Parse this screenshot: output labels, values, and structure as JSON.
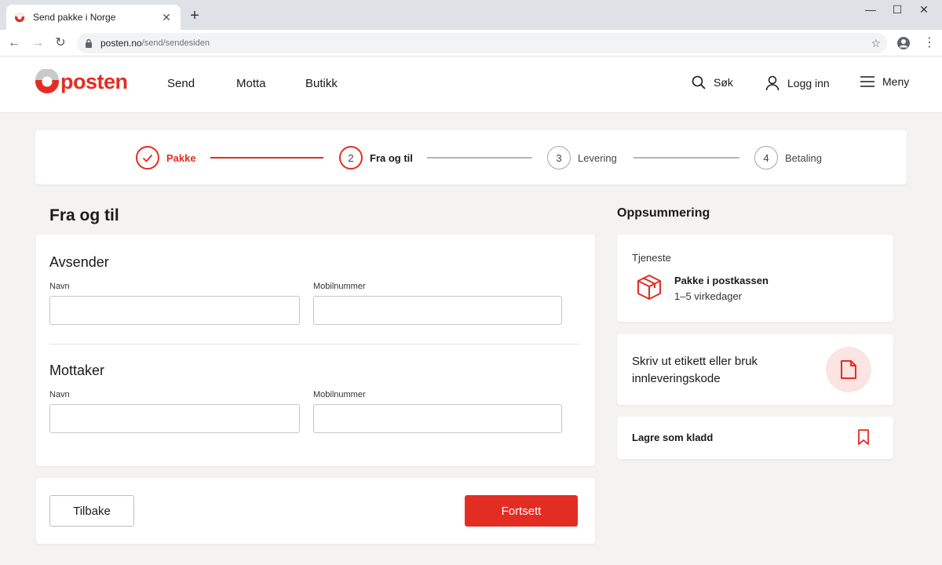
{
  "browser": {
    "tab_title": "Send pakke i Norge",
    "url_host": "posten.no",
    "url_path": "/send/sendesiden"
  },
  "header": {
    "logo_text": "posten",
    "nav": [
      "Send",
      "Motta",
      "Butikk"
    ],
    "search_label": "Søk",
    "login_label": "Logg inn",
    "menu_label": "Meny"
  },
  "stepper": {
    "steps": [
      {
        "number": "",
        "label": "Pakke",
        "state": "done"
      },
      {
        "number": "2",
        "label": "Fra og til",
        "state": "active"
      },
      {
        "number": "3",
        "label": "Levering",
        "state": "pending"
      },
      {
        "number": "4",
        "label": "Betaling",
        "state": "pending"
      }
    ]
  },
  "form": {
    "title": "Fra og til",
    "sender": {
      "title": "Avsender",
      "name_label": "Navn",
      "name_value": "",
      "phone_label": "Mobilnummer",
      "phone_value": ""
    },
    "recipient": {
      "title": "Mottaker",
      "name_label": "Navn",
      "name_value": "",
      "phone_label": "Mobilnummer",
      "phone_value": ""
    },
    "back_label": "Tilbake",
    "continue_label": "Fortsett"
  },
  "summary": {
    "title": "Oppsummering",
    "service_label": "Tjeneste",
    "service_name": "Pakke i postkassen",
    "service_time": "1–5 virkedager",
    "print_text": "Skriv ut etikett eller bruk innleveringskode",
    "draft_label": "Lagre som kladd"
  },
  "colors": {
    "brand_red": "#e32d22",
    "background": "#f4f3f2",
    "icon_bg": "#fbe4e2"
  }
}
